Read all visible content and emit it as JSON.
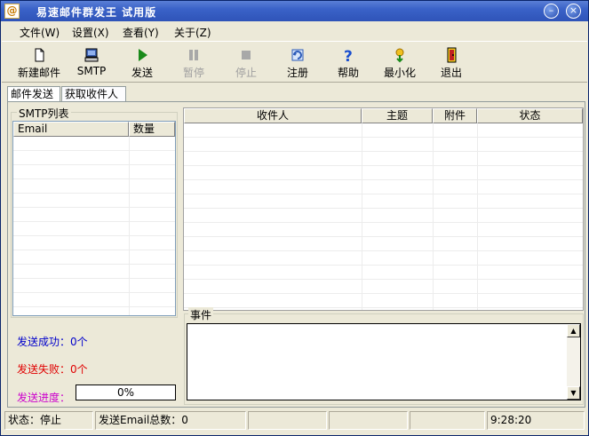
{
  "window": {
    "title": "易速邮件群发王 试用版",
    "icon_glyph": "@"
  },
  "titlebar_buttons": {
    "minimize": "–",
    "close": "×"
  },
  "menu": [
    "文件(W)",
    "设置(X)",
    "查看(Y)",
    "关于(Z)"
  ],
  "toolbar": [
    {
      "label": "新建邮件",
      "icon": "new-document-icon",
      "enabled": true
    },
    {
      "label": "SMTP",
      "icon": "computer-icon",
      "enabled": true
    },
    {
      "label": "发送",
      "icon": "play-icon",
      "enabled": true
    },
    {
      "label": "暂停",
      "icon": "pause-icon",
      "enabled": false
    },
    {
      "label": "停止",
      "icon": "stop-icon",
      "enabled": false
    },
    {
      "label": "注册",
      "icon": "register-icon",
      "enabled": true
    },
    {
      "label": "帮助",
      "icon": "help-icon",
      "enabled": true
    },
    {
      "label": "最小化",
      "icon": "minimize-icon",
      "enabled": true
    },
    {
      "label": "退出",
      "icon": "exit-door-icon",
      "enabled": true
    }
  ],
  "tabs": [
    {
      "label": "邮件发送",
      "active": true
    },
    {
      "label": "获取收件人",
      "active": false
    }
  ],
  "smtp_group": {
    "title": "SMTP列表",
    "columns": [
      "Email",
      "数量"
    ]
  },
  "recipients_table": {
    "columns": [
      "收件人",
      "主题",
      "附件",
      "状态"
    ]
  },
  "stats": {
    "success": "发送成功：0个",
    "failed": "发送失败：0个",
    "progress_label": "发送进度：",
    "progress_text": "0%",
    "progress_fraction": 0
  },
  "events": {
    "title": "事件"
  },
  "statusbar": {
    "state": "状态：停止",
    "total": "发送Email总数：0",
    "time": "9:28:20"
  },
  "colors": {
    "title_bar": "#3a62c8",
    "success_text": "#0000cc",
    "failed_text": "#e00000",
    "progress_label_text": "#cc00cc"
  }
}
